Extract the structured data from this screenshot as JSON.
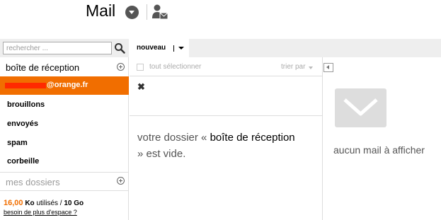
{
  "header": {
    "app_title": "Mail",
    "icons": [
      "dropdown-icon",
      "contact-mail-icon"
    ]
  },
  "search": {
    "placeholder": "rechercher ..."
  },
  "sidebar": {
    "inbox_label": "boîte de réception",
    "account_label": "@orange.fr",
    "folders": [
      "brouillons",
      "envoyés",
      "spam",
      "corbeille"
    ],
    "my_folders_label": "mes dossiers",
    "quota": {
      "used": "16,00",
      "unit": "Ko",
      "used_suffix": "utilisés /",
      "total": "10 Go"
    },
    "more_space_link": "besoin de plus d'espace ?"
  },
  "toolbar": {
    "new_label": "nouveau"
  },
  "list": {
    "select_all_label": "tout sélectionner",
    "sort_label": "trier par",
    "empty_prefix": "votre dossier «",
    "empty_folder": "boîte de réception",
    "empty_suffix": "» est vide."
  },
  "reader": {
    "no_mail_label": "aucun mail à afficher"
  },
  "colors": {
    "accent": "#f16e00",
    "redaction": "#ff2a00",
    "toolbar_bg": "#eeeeee"
  }
}
